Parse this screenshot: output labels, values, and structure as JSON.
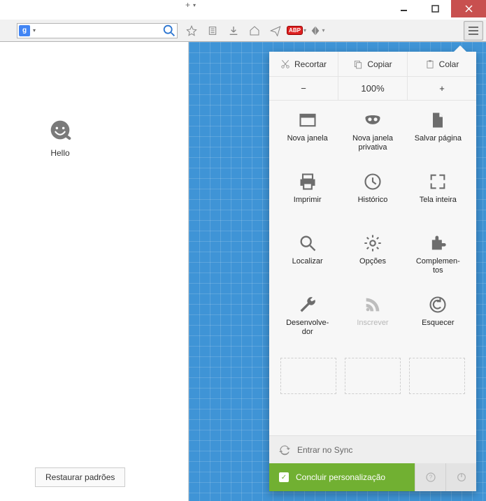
{
  "window": {
    "min": "—",
    "max": "▢",
    "close": "✕"
  },
  "tabstrip": {
    "addLabel": "+"
  },
  "search": {
    "engine": "g",
    "placeholder": ""
  },
  "abp": "ABP",
  "leftPane": {
    "helloLabel": "Hello",
    "restoreLabel": "Restaurar padrões"
  },
  "panel": {
    "cut": "Recortar",
    "copy": "Copiar",
    "paste": "Colar",
    "zoomOut": "−",
    "zoomLevel": "100%",
    "zoomIn": "+",
    "items": [
      {
        "label": "Nova janela"
      },
      {
        "label": "Nova janela privativa"
      },
      {
        "label": "Salvar página"
      },
      {
        "label": "Imprimir"
      },
      {
        "label": "Histórico"
      },
      {
        "label": "Tela inteira"
      },
      {
        "label": "Localizar"
      },
      {
        "label": "Opções"
      },
      {
        "label": "Complemen-\ntos"
      },
      {
        "label": "Desenvolve-\ndor"
      },
      {
        "label": "Inscrever"
      },
      {
        "label": "Esquecer"
      }
    ],
    "syncLabel": "Entrar no Sync",
    "doneLabel": "Concluir personalização"
  }
}
